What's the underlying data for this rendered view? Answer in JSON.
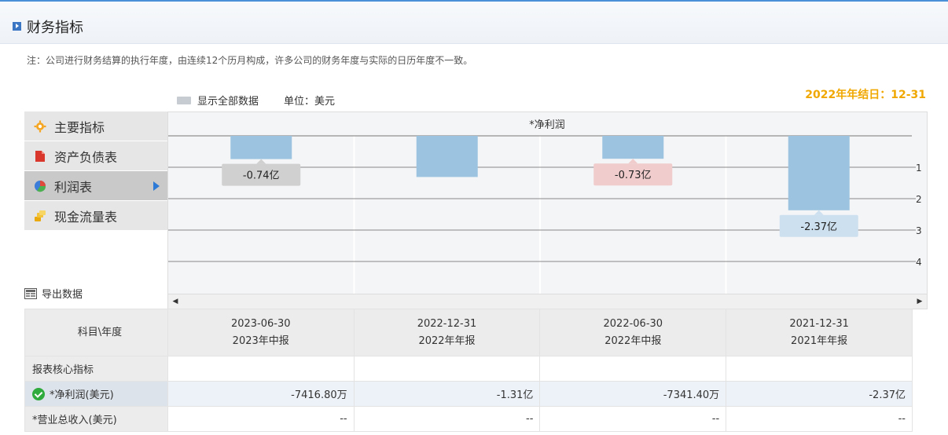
{
  "header": {
    "title": "财务指标"
  },
  "note": "注：公司进行财务结算的执行年度，由连续12个历月构成，许多公司的财务年度与实际的日历年度不一致。",
  "legend": {
    "label": "显示全部数据",
    "unit": "单位：美元"
  },
  "year_end": "2022年年结日：12-31",
  "menu": [
    {
      "label": "主要指标",
      "icon": "gear-icon"
    },
    {
      "label": "资产负债表",
      "icon": "document-icon"
    },
    {
      "label": "利润表",
      "icon": "pie-chart-icon",
      "active": true
    },
    {
      "label": "现金流量表",
      "icon": "coins-icon"
    }
  ],
  "export_label": "导出数据",
  "chart_data": {
    "type": "bar",
    "title": "*净利润",
    "categories": [
      "2023-06-30",
      "2022-12-31",
      "2022-06-30",
      "2021-12-31"
    ],
    "values": [
      -0.74,
      -1.31,
      -0.73,
      -2.37
    ],
    "data_labels": [
      "-0.74亿",
      "",
      "-0.73亿",
      "-2.37亿"
    ],
    "yticks": [
      "1",
      "2",
      "3",
      "4"
    ],
    "ylim": [
      -4,
      0
    ],
    "grid": true,
    "colors": {
      "bar": "#9cc4e0",
      "label_gray": "#d0d0d0",
      "label_red": "#f0cccc",
      "label_blue": "#cde0ef"
    }
  },
  "table": {
    "corner": "科目\\年度",
    "columns": [
      {
        "date": "2023-06-30",
        "period": "2023年中报"
      },
      {
        "date": "2022-12-31",
        "period": "2022年年报"
      },
      {
        "date": "2022-06-30",
        "period": "2022年中报"
      },
      {
        "date": "2021-12-31",
        "period": "2021年年报"
      }
    ],
    "rows": [
      {
        "label": "报表核心指标",
        "values": [
          "",
          "",
          "",
          ""
        ]
      },
      {
        "label": "*净利润(美元)",
        "values": [
          "-7416.80万",
          "-1.31亿",
          "-7341.40万",
          "-2.37亿"
        ]
      },
      {
        "label": "*营业总收入(美元)",
        "values": [
          "--",
          "--",
          "--",
          "--"
        ]
      }
    ]
  }
}
